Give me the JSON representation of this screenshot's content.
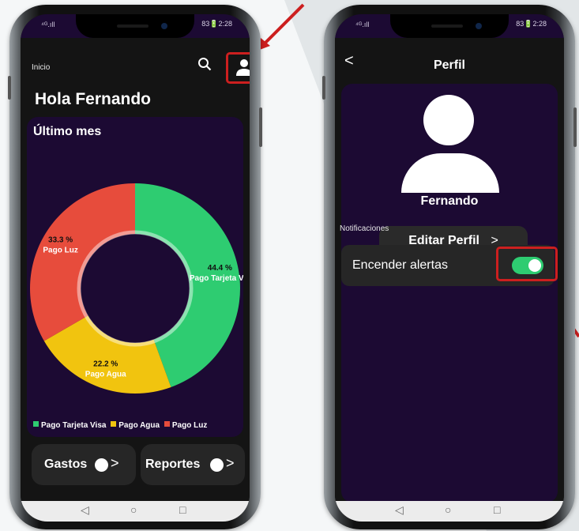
{
  "left_phone": {
    "status": {
      "signal": "⁴ᴳ.ıll",
      "time": "2:28",
      "battery": "83"
    },
    "topbar": {
      "label": "Inicio",
      "search_icon": "search-icon",
      "user_icon": "user-icon"
    },
    "greeting": "Hola Fernando",
    "chart_card": {
      "title": "Último mes"
    },
    "chart_data": {
      "type": "pie",
      "donut": true,
      "categories": [
        "Pago Tarjeta Visa",
        "Pago Agua",
        "Pago Luz"
      ],
      "values": [
        44.4,
        22.2,
        33.3
      ],
      "colors": [
        "#2ecc71",
        "#f1c40f",
        "#e74c3c"
      ],
      "value_labels": [
        "44.4 %",
        "22.2 %",
        "33.3 %"
      ],
      "slice_names": [
        "Pago Tarjeta Vis",
        "Pago Agua",
        "Pago Luz"
      ],
      "legend": [
        "Pago Tarjeta Visa",
        "Pago Agua",
        "Pago Luz"
      ],
      "legend_position": "bottom"
    },
    "buttons": [
      {
        "label": "Gastos",
        "chevron": ">"
      },
      {
        "label": "Reportes",
        "chevron": ">"
      }
    ],
    "nav": {
      "back": "◁",
      "home": "○",
      "recents": "□"
    }
  },
  "right_phone": {
    "status": {
      "signal": "⁴ᴳ.ıll",
      "time": "2:28",
      "battery": "83"
    },
    "back_label": "<",
    "title": "Perfil",
    "user_name": "Fernando",
    "edit_label": "Editar Perfil",
    "edit_chevron": ">",
    "notifications_label": "Notificaciones",
    "alerts_label": "Encender alertas",
    "alerts_on": true,
    "nav": {
      "back": "◁",
      "home": "○",
      "recents": "□"
    }
  },
  "colors": {
    "accent_red": "#cc1f1f",
    "card_bg": "#1c0a33",
    "toggle_on": "#2ecc71"
  }
}
